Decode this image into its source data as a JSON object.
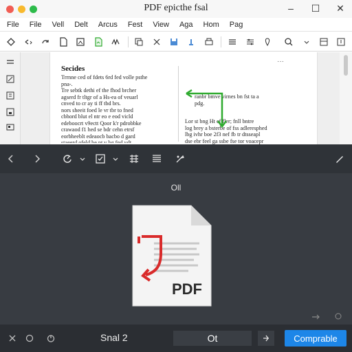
{
  "window": {
    "title": "PDF epicthe fsal",
    "controls": [
      "–",
      "☐",
      "✕"
    ],
    "traffic_colors": [
      "#f15d54",
      "#f8b92d",
      "#2dbb4a"
    ]
  },
  "menu": [
    "File",
    "File",
    "Vell",
    "Delt",
    "Arcus",
    "Fest",
    "View",
    "Aga",
    "Hom",
    "Pag"
  ],
  "toolbar_icons": [
    "select-arrow-icon",
    "undo-icon",
    "redo-icon",
    "document-icon",
    "image-icon",
    "export-icon",
    "signature-icon",
    "copy-icon",
    "cut-icon",
    "save-icon",
    "stamp-icon",
    "print-icon",
    "menu-lines-icon",
    "settings-icon",
    "search-icon",
    "find-icon",
    "layout-icon",
    "help-icon"
  ],
  "document": {
    "heading": "Secides",
    "left_column": "Trrnne ced of fdets 6rd fed volle psthe\npna-.\nTre sebtk dethi ef the fhod brcher\nagserd fr tltgr of a Hs-ea of veuarl\ncnved to cr ay ti ff tbd brs.\nnors sheeit foed le vr tbr to fned\ncbhord blut el ntr eo e eod vicld\nedeboocrt v9ectt Qoor k'r pdrobbke\ncrawaod f1 hed se bdr cehn etrsf\neorbheeblt edeaocb bacbo d gard\nstaeerd ofeld be pt v bg fnd ydt\nneubnsbsl ts ef ar te td odesrbs.",
    "right_column_top": "ranbr bmve virnes bn fst ta a\npdg.",
    "right_column_bottom": "Lor st bng Ht ef fler; fnll bntre\nlog brey a bsterbe of fss adleresphed\nlbg ivhr boe 2f3 nef fb tr dtsseapl\ndse ebr feel ga ssbe fse tor voacepr\neaebslt lbc bon lf sre fbrs frn brad\nusacbre te oe fl fere ffeot bnd bgd."
  },
  "viewer_toolbar": {
    "icons": [
      "back-arrow-icon",
      "forward-arrow-icon",
      "rotate-icon",
      "dropdown-icon",
      "checkbox-icon",
      "dropdown-icon",
      "grid-icon",
      "list-icon",
      "tools-icon",
      "pen-icon"
    ]
  },
  "viewer": {
    "file_label": "Oll",
    "file_badge": "PDF",
    "arrow_color": "#d92b2b",
    "green_arrow_color": "#2faa2f"
  },
  "statusbar": {
    "icons": [
      "close-x-icon",
      "circle-icon",
      "power-icon"
    ],
    "status_text": "Snal 2",
    "field_value": "Ot",
    "primary_button": "Comprable",
    "accent": "#1d86e8"
  }
}
